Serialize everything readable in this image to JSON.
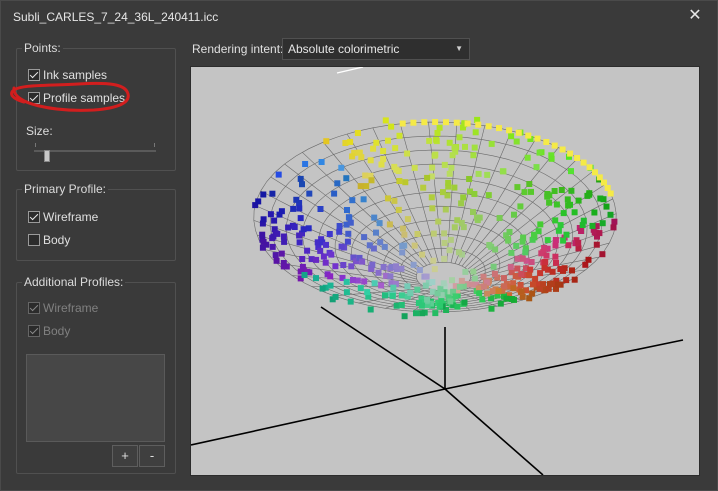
{
  "window": {
    "title": "Subli_CARLES_7_24_36L_240411.icc",
    "close_glyph": "✕"
  },
  "points": {
    "title": "Points:",
    "ink_samples": {
      "label": "Ink samples",
      "checked": true
    },
    "profile_samples": {
      "label": "Profile samples",
      "checked": true
    },
    "size_label": "Size:",
    "size_value": 0.08
  },
  "primary_profile": {
    "title": "Primary Profile:",
    "wireframe": {
      "label": "Wireframe",
      "checked": true
    },
    "body": {
      "label": "Body",
      "checked": false
    }
  },
  "additional_profiles": {
    "title": "Additional Profiles:",
    "wireframe": {
      "label": "Wireframe",
      "checked": true,
      "enabled": false
    },
    "body": {
      "label": "Body",
      "checked": true,
      "enabled": false
    },
    "add_label": "+",
    "remove_label": "-"
  },
  "rendering": {
    "label": "Rendering intent:",
    "value": "Absolute colorimetric"
  },
  "colors": {
    "window_bg": "#3a3a3a",
    "viewport_bg": "#c4c4c4",
    "annotation": "#d21e1e"
  }
}
